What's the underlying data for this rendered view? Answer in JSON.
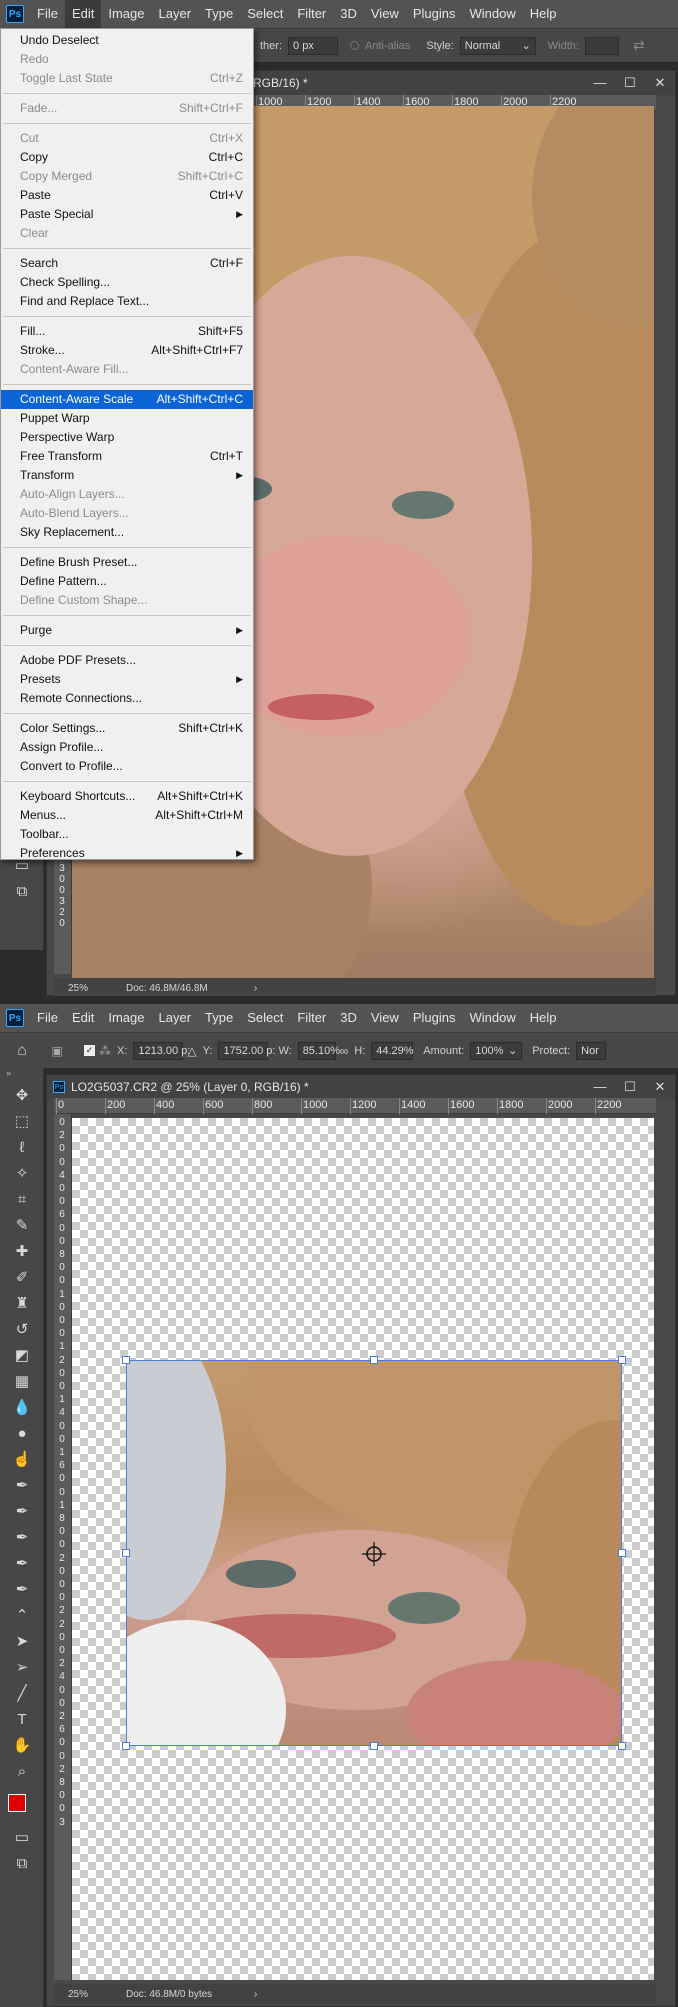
{
  "top": {
    "menubar": [
      "File",
      "Edit",
      "Image",
      "Layer",
      "Type",
      "Select",
      "Filter",
      "3D",
      "View",
      "Plugins",
      "Window",
      "Help"
    ],
    "options": {
      "feather_label": "ther:",
      "feather_value": "0 px",
      "antialias": "Anti-alias",
      "style_label": "Style:",
      "style_value": "Normal",
      "width_label": "Width:"
    },
    "tab_title": "RGB/16) *",
    "ruler_ticks": [
      "1000",
      "1200",
      "1400",
      "1600",
      "1800",
      "2000",
      "2200"
    ],
    "vruler_digits": [
      "3",
      "0",
      "0",
      "3",
      "2",
      "0"
    ],
    "status": {
      "zoom": "25%",
      "doc": "Doc: 46.8M/46.8M"
    },
    "edit_menu": [
      {
        "label": "Undo Deselect",
        "shortcut": "",
        "disabled": false
      },
      {
        "label": "Redo",
        "shortcut": "",
        "disabled": true
      },
      {
        "label": "Toggle Last State",
        "shortcut": "Ctrl+Z",
        "disabled": true
      },
      {
        "sep": true
      },
      {
        "label": "Fade...",
        "shortcut": "Shift+Ctrl+F",
        "disabled": true
      },
      {
        "sep": true
      },
      {
        "label": "Cut",
        "shortcut": "Ctrl+X",
        "disabled": true
      },
      {
        "label": "Copy",
        "shortcut": "Ctrl+C",
        "disabled": false
      },
      {
        "label": "Copy Merged",
        "shortcut": "Shift+Ctrl+C",
        "disabled": true
      },
      {
        "label": "Paste",
        "shortcut": "Ctrl+V",
        "disabled": false
      },
      {
        "label": "Paste Special",
        "shortcut": "",
        "submenu": true,
        "disabled": false
      },
      {
        "label": "Clear",
        "shortcut": "",
        "disabled": true
      },
      {
        "sep": true
      },
      {
        "label": "Search",
        "shortcut": "Ctrl+F",
        "disabled": false
      },
      {
        "label": "Check Spelling...",
        "shortcut": "",
        "disabled": false
      },
      {
        "label": "Find and Replace Text...",
        "shortcut": "",
        "disabled": false
      },
      {
        "sep": true
      },
      {
        "label": "Fill...",
        "shortcut": "Shift+F5",
        "disabled": false
      },
      {
        "label": "Stroke...",
        "shortcut": "Alt+Shift+Ctrl+F7",
        "disabled": false
      },
      {
        "label": "Content-Aware Fill...",
        "shortcut": "",
        "disabled": true
      },
      {
        "sep": true
      },
      {
        "label": "Content-Aware Scale",
        "shortcut": "Alt+Shift+Ctrl+C",
        "disabled": false,
        "highlighted": true
      },
      {
        "label": "Puppet Warp",
        "shortcut": "",
        "disabled": false
      },
      {
        "label": "Perspective Warp",
        "shortcut": "",
        "disabled": false
      },
      {
        "label": "Free Transform",
        "shortcut": "Ctrl+T",
        "disabled": false
      },
      {
        "label": "Transform",
        "shortcut": "",
        "submenu": true,
        "disabled": false
      },
      {
        "label": "Auto-Align Layers...",
        "shortcut": "",
        "disabled": true
      },
      {
        "label": "Auto-Blend Layers...",
        "shortcut": "",
        "disabled": true
      },
      {
        "label": "Sky Replacement...",
        "shortcut": "",
        "disabled": false
      },
      {
        "sep": true
      },
      {
        "label": "Define Brush Preset...",
        "shortcut": "",
        "disabled": false
      },
      {
        "label": "Define Pattern...",
        "shortcut": "",
        "disabled": false
      },
      {
        "label": "Define Custom Shape...",
        "shortcut": "",
        "disabled": true
      },
      {
        "sep": true
      },
      {
        "label": "Purge",
        "shortcut": "",
        "submenu": true,
        "disabled": false
      },
      {
        "sep": true
      },
      {
        "label": "Adobe PDF Presets...",
        "shortcut": "",
        "disabled": false
      },
      {
        "label": "Presets",
        "shortcut": "",
        "submenu": true,
        "disabled": false
      },
      {
        "label": "Remote Connections...",
        "shortcut": "",
        "disabled": false
      },
      {
        "sep": true
      },
      {
        "label": "Color Settings...",
        "shortcut": "Shift+Ctrl+K",
        "disabled": false
      },
      {
        "label": "Assign Profile...",
        "shortcut": "",
        "disabled": false
      },
      {
        "label": "Convert to Profile...",
        "shortcut": "",
        "disabled": false
      },
      {
        "sep": true
      },
      {
        "label": "Keyboard Shortcuts...",
        "shortcut": "Alt+Shift+Ctrl+K",
        "disabled": false
      },
      {
        "label": "Menus...",
        "shortcut": "Alt+Shift+Ctrl+M",
        "disabled": false
      },
      {
        "label": "Toolbar...",
        "shortcut": "",
        "disabled": false
      },
      {
        "label": "Preferences",
        "shortcut": "",
        "submenu": true,
        "disabled": false
      }
    ]
  },
  "bottom": {
    "menubar": [
      "File",
      "Edit",
      "Image",
      "Layer",
      "Type",
      "Select",
      "Filter",
      "3D",
      "View",
      "Plugins",
      "Window",
      "Help"
    ],
    "options": {
      "x_label": "X:",
      "x_value": "1213.00 p:",
      "y_label": "Y:",
      "y_value": "1752.00 p:",
      "w_label": "W:",
      "w_value": "85.10%",
      "h_label": "H:",
      "h_value": "44.29%",
      "amount_label": "Amount:",
      "amount_value": "100%",
      "protect_label": "Protect:",
      "protect_value": "Nor"
    },
    "tab_title": "LO2G5037.CR2 @ 25% (Layer 0, RGB/16) *",
    "ruler_ticks": [
      "0",
      "200",
      "400",
      "600",
      "800",
      "1000",
      "1200",
      "1400",
      "1600",
      "1800",
      "2000",
      "2200"
    ],
    "vruler_digits": [
      "0",
      "2",
      "0",
      "0",
      "4",
      "0",
      "0",
      "6",
      "0",
      "0",
      "8",
      "0",
      "0",
      "1",
      "0",
      "0",
      "0",
      "1",
      "2",
      "0",
      "0",
      "1",
      "4",
      "0",
      "0",
      "1",
      "6",
      "0",
      "0",
      "1",
      "8",
      "0",
      "0",
      "2",
      "0",
      "0",
      "0",
      "2",
      "2",
      "0",
      "0",
      "2",
      "4",
      "0",
      "0",
      "2",
      "6",
      "0",
      "0",
      "2",
      "8",
      "0",
      "0",
      "3"
    ],
    "status": {
      "zoom": "25%",
      "doc": "Doc: 46.8M/0 bytes"
    }
  }
}
